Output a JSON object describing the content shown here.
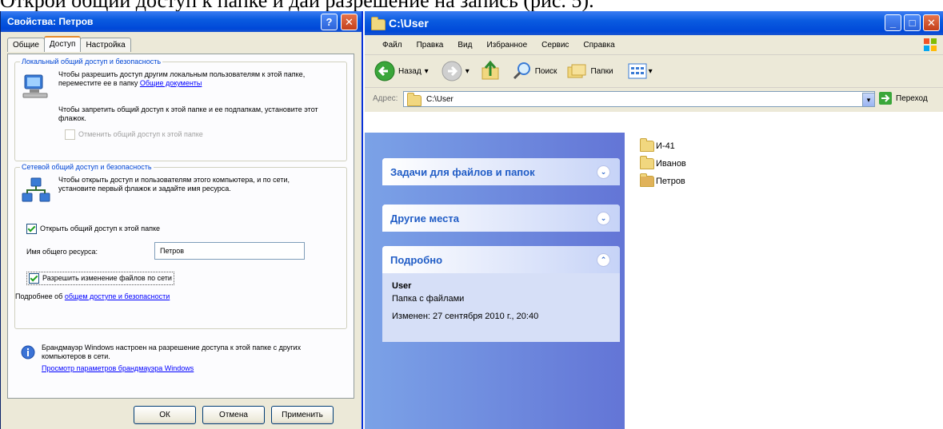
{
  "cut_text": "Открой общий доступ к папке и дай разрешение на запись (рис. 5).",
  "dialog": {
    "title": "Свойства: Петров",
    "tabs": [
      "Общие",
      "Доступ",
      "Настройка"
    ],
    "local_group": {
      "legend": "Локальный общий доступ и безопасность",
      "text1": "Чтобы разрешить доступ другим локальным пользователям к этой папке, переместите ее в папку",
      "link1": "Общие документы",
      "text2": "Чтобы запретить общий доступ к этой папке и ее подпапкам, установите этот флажок.",
      "checkbox_private": "Отменить общий доступ к этой папке"
    },
    "network_group": {
      "legend": "Сетевой общий доступ и безопасность",
      "text": "Чтобы открыть доступ и пользователям этого компьютера, и по сети, установите первый флажок и задайте имя ресурса.",
      "checkbox_share": "Открыть общий доступ к этой папке",
      "share_name_label": "Имя общего ресурса:",
      "share_name_value": "Петров",
      "checkbox_allow": "Разрешить изменение файлов по сети",
      "more_prefix": "Подробнее об",
      "more_link": "общем доступе и безопасности"
    },
    "firewall_text": "Брандмауэр Windows настроен на разрешение доступа к этой папке с других компьютеров в сети.",
    "firewall_link": "Просмотр параметров брандмауэра Windows",
    "buttons": {
      "ok": "ОК",
      "cancel": "Отмена",
      "apply": "Применить"
    }
  },
  "explorer": {
    "title": "C:\\User",
    "menu": [
      "Файл",
      "Правка",
      "Вид",
      "Избранное",
      "Сервис",
      "Справка"
    ],
    "toolbar": {
      "back": "Назад",
      "search": "Поиск",
      "folders": "Папки"
    },
    "address_label": "Адрес:",
    "address_value": "C:\\User",
    "go_label": "Переход",
    "tasks": {
      "file_tasks": "Задачи для файлов и папок",
      "other_places": "Другие места",
      "details": "Подробно",
      "details_name": "User",
      "details_type": "Папка с файлами",
      "details_modified": "Изменен: 27 сентября 2010 г., 20:40"
    },
    "files": [
      "И-41",
      "Иванов",
      "Петров"
    ]
  },
  "colors": {
    "xp_blue": "#0054e3",
    "task_pane": "#7ba2e7",
    "link": "#0000ff",
    "legend": "#0046d5"
  }
}
